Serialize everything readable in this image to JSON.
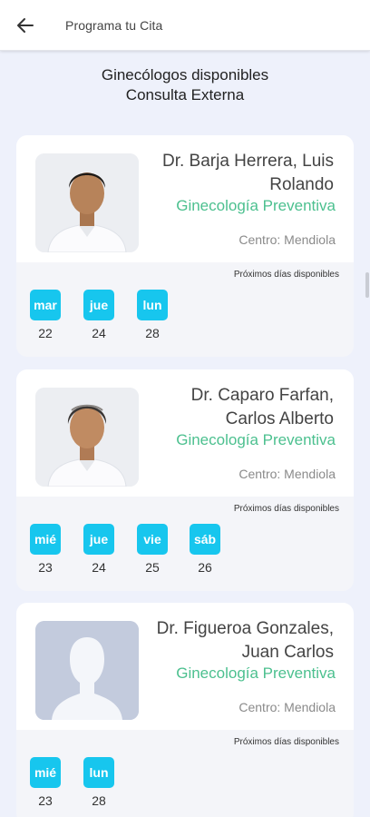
{
  "app_bar": {
    "title": "Programa tu Cita",
    "back_icon": "arrow-left-icon"
  },
  "heading": {
    "line1": "Ginecólogos disponibles",
    "line2": "Consulta Externa"
  },
  "next_days_label": "Próximos días disponibles",
  "colors": {
    "accent": "#17c6ee",
    "specialty": "#4cc08f",
    "background": "#eef1fb"
  },
  "doctors": [
    {
      "name": "Dr. Barja Herrera, Luis Rolando",
      "specialty": "Ginecología Preventiva",
      "center": "Centro: Mendiola",
      "days": [
        {
          "dow": "mar",
          "day": "22"
        },
        {
          "dow": "jue",
          "day": "24"
        },
        {
          "dow": "lun",
          "day": "28"
        }
      ]
    },
    {
      "name": "Dr. Caparo Farfan, Carlos Alberto",
      "specialty": "Ginecología Preventiva",
      "center": "Centro: Mendiola",
      "days": [
        {
          "dow": "mié",
          "day": "23"
        },
        {
          "dow": "jue",
          "day": "24"
        },
        {
          "dow": "vie",
          "day": "25"
        },
        {
          "dow": "sáb",
          "day": "26"
        }
      ]
    },
    {
      "name": "Dr. Figueroa Gonzales, Juan Carlos",
      "specialty": "Ginecología Preventiva",
      "center": "Centro: Mendiola",
      "days": [
        {
          "dow": "mié",
          "day": "23"
        },
        {
          "dow": "lun",
          "day": "28"
        }
      ]
    }
  ]
}
